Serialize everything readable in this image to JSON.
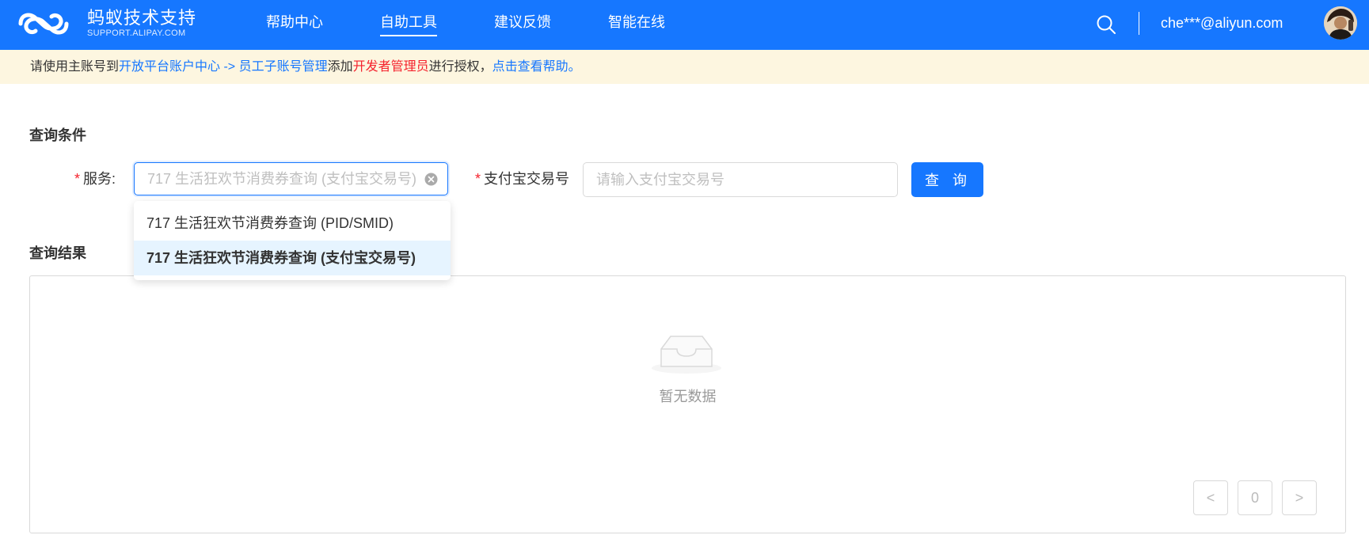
{
  "header": {
    "logo_title": "蚂蚁技术支持",
    "logo_subtitle": "SUPPORT.ALIPAY.COM",
    "nav": [
      {
        "label": "帮助中心"
      },
      {
        "label": "自助工具"
      },
      {
        "label": "建议反馈"
      },
      {
        "label": "智能在线"
      }
    ],
    "active_nav": "自助工具",
    "user_email": "che***@aliyun.com"
  },
  "notice": {
    "part1": "请使用主账号到",
    "link1": "开放平台账户中心 -> 员工子账号管理",
    "part2": "添加",
    "highlight": "开发者管理员",
    "part3": "进行授权，",
    "link2": "点击查看帮助。"
  },
  "query": {
    "section_title": "查询条件",
    "service_label": "服务",
    "service_colon": ":",
    "service_value": "717 生活狂欢节消费券查询 (支付宝交易号)",
    "trade_label": "支付宝交易号",
    "trade_placeholder": "请输入支付宝交易号",
    "query_button": "查 询",
    "required_mark": "*"
  },
  "dropdown": {
    "options": [
      {
        "label": "717 生活狂欢节消费券查询 (PID/SMID)"
      },
      {
        "label": "717 生活狂欢节消费券查询 (支付宝交易号)"
      }
    ],
    "selected_index": 1
  },
  "results": {
    "section_title": "查询结果",
    "empty_text": "暂无数据",
    "pagination": {
      "prev": "<",
      "page": "0",
      "next": ">"
    }
  },
  "colors": {
    "brand": "#1677ff",
    "notice_bg": "#fdf6e0",
    "danger": "#f5222d"
  }
}
